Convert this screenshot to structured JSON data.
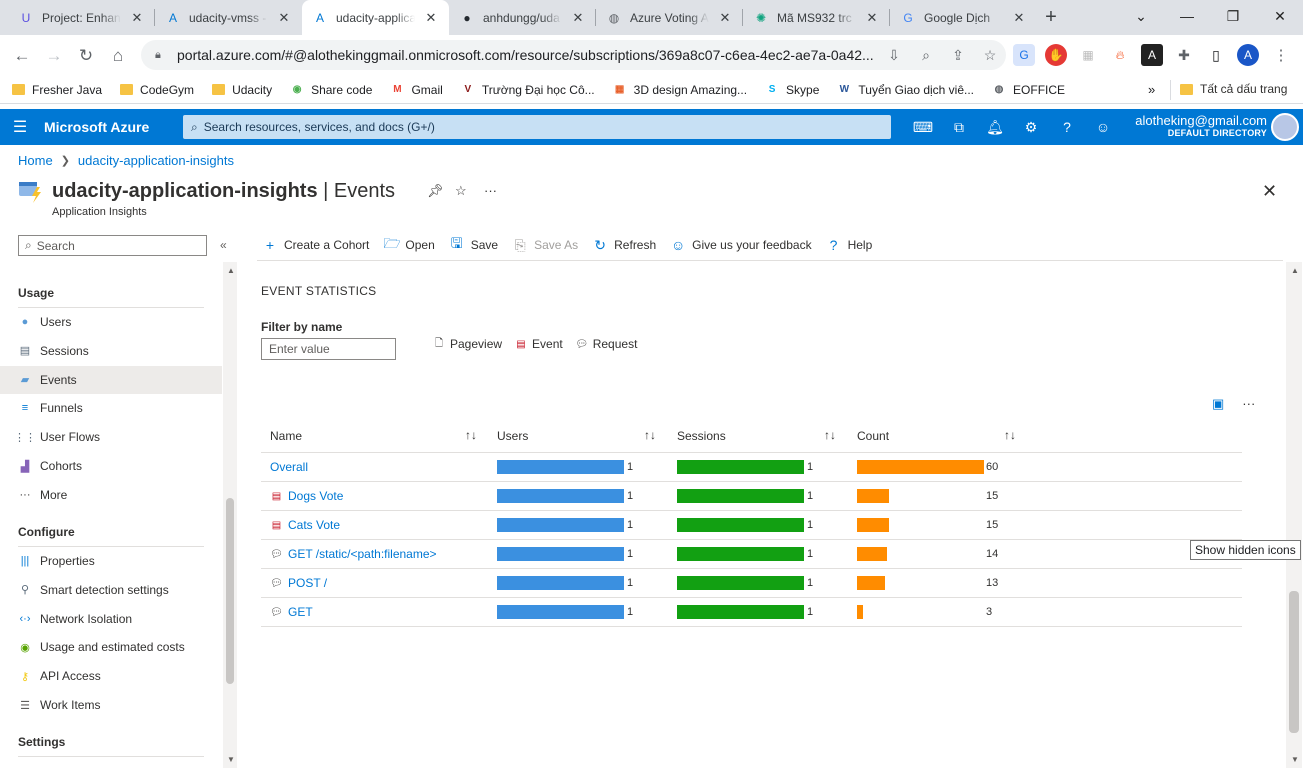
{
  "browser": {
    "tabs": [
      {
        "title": "Project: Enhanc",
        "icon": "udacity-icon",
        "color": "#5a4fe0",
        "glyph": "U"
      },
      {
        "title": "udacity-vmss -",
        "icon": "azure-icon",
        "color": "#0078d4",
        "glyph": "A"
      },
      {
        "title": "udacity-applica",
        "icon": "azure-icon",
        "color": "#0078d4",
        "glyph": "A"
      },
      {
        "title": "anhdungg/uda",
        "icon": "github-icon",
        "color": "#24292f",
        "glyph": "●"
      },
      {
        "title": "Azure Voting A",
        "icon": "globe-icon",
        "color": "#5f6368",
        "glyph": "◍"
      },
      {
        "title": "Mã MS932 trc",
        "icon": "chatgpt-icon",
        "color": "#10a37f",
        "glyph": "✺"
      },
      {
        "title": "Google Dịch",
        "icon": "translate-icon",
        "color": "#4285f4",
        "glyph": "G"
      }
    ],
    "url": "portal.azure.com/#@alothekinggmail.onmicrosoft.com/resource/subscriptions/369a8c07-c6ea-4ec2-ae7a-0a42...",
    "bookmarks": [
      {
        "label": "Fresher Java",
        "icon": "folder-icon"
      },
      {
        "label": "CodeGym",
        "icon": "folder-icon"
      },
      {
        "label": "Udacity",
        "icon": "folder-icon"
      },
      {
        "label": "Share code",
        "icon": "share-code-icon"
      },
      {
        "label": "Gmail",
        "icon": "gmail-icon"
      },
      {
        "label": "Trường Đại học Cô...",
        "icon": "university-icon"
      },
      {
        "label": "3D design Amazing...",
        "icon": "tinkercad-icon"
      },
      {
        "label": "Skype",
        "icon": "skype-icon"
      },
      {
        "label": "Tuyển Giao dịch viê...",
        "icon": "word-icon"
      },
      {
        "label": "EOFFICE",
        "icon": "globe-icon"
      }
    ],
    "bookmarks_more": "»",
    "all_bookmarks": "Tất cả dấu trang"
  },
  "azure": {
    "brand": "Microsoft Azure",
    "search_placeholder": "Search resources, services, and docs (G+/)",
    "account_email": "alotheking@gmail.com",
    "account_directory": "DEFAULT DIRECTORY"
  },
  "breadcrumb": {
    "home": "Home",
    "resource": "udacity-application-insights"
  },
  "blade": {
    "resource_name": "udacity-application-insights",
    "separator": " | ",
    "page": "Events",
    "subtitle": "Application Insights"
  },
  "sidebar": {
    "search_placeholder": "Search",
    "groups": [
      {
        "label": "Usage",
        "items": [
          {
            "label": "Users",
            "icon": "users-icon"
          },
          {
            "label": "Sessions",
            "icon": "sessions-icon"
          },
          {
            "label": "Events",
            "icon": "events-icon",
            "selected": true
          },
          {
            "label": "Funnels",
            "icon": "funnels-icon"
          },
          {
            "label": "User Flows",
            "icon": "user-flows-icon"
          },
          {
            "label": "Cohorts",
            "icon": "cohorts-icon"
          },
          {
            "label": "More",
            "icon": "more-icon"
          }
        ]
      },
      {
        "label": "Configure",
        "items": [
          {
            "label": "Properties",
            "icon": "properties-icon"
          },
          {
            "label": "Smart detection settings",
            "icon": "smart-detection-icon"
          },
          {
            "label": "Network Isolation",
            "icon": "network-isolation-icon"
          },
          {
            "label": "Usage and estimated costs",
            "icon": "costs-icon"
          },
          {
            "label": "API Access",
            "icon": "api-key-icon"
          },
          {
            "label": "Work Items",
            "icon": "work-items-icon"
          }
        ]
      },
      {
        "label": "Settings",
        "items": []
      }
    ]
  },
  "toolbar": {
    "create_cohort": "Create a Cohort",
    "open": "Open",
    "save": "Save",
    "save_as": "Save As",
    "refresh": "Refresh",
    "feedback": "Give us your feedback",
    "help": "Help"
  },
  "events": {
    "section_title": "EVENT STATISTICS",
    "filter_label": "Filter by name",
    "filter_placeholder": "Enter value",
    "legend": {
      "pageview": "Pageview",
      "event": "Event",
      "request": "Request"
    },
    "columns": {
      "name": "Name",
      "users": "Users",
      "sessions": "Sessions",
      "count": "Count"
    },
    "colors": {
      "users": "#3b90e0",
      "sessions": "#12a012",
      "count": "#ff8c00"
    },
    "max_count": 60,
    "rows": [
      {
        "name": "Overall",
        "type": "overall",
        "users": 1,
        "sessions": 1,
        "count": 60
      },
      {
        "name": "Dogs Vote",
        "type": "event",
        "users": 1,
        "sessions": 1,
        "count": 15
      },
      {
        "name": "Cats Vote",
        "type": "event",
        "users": 1,
        "sessions": 1,
        "count": 15
      },
      {
        "name": "GET /static/<path:filename>",
        "type": "request",
        "users": 1,
        "sessions": 1,
        "count": 14
      },
      {
        "name": "POST /",
        "type": "request",
        "users": 1,
        "sessions": 1,
        "count": 13
      },
      {
        "name": "GET",
        "type": "request",
        "users": 1,
        "sessions": 1,
        "count": 3
      }
    ]
  },
  "tooltip": "Show hidden icons"
}
